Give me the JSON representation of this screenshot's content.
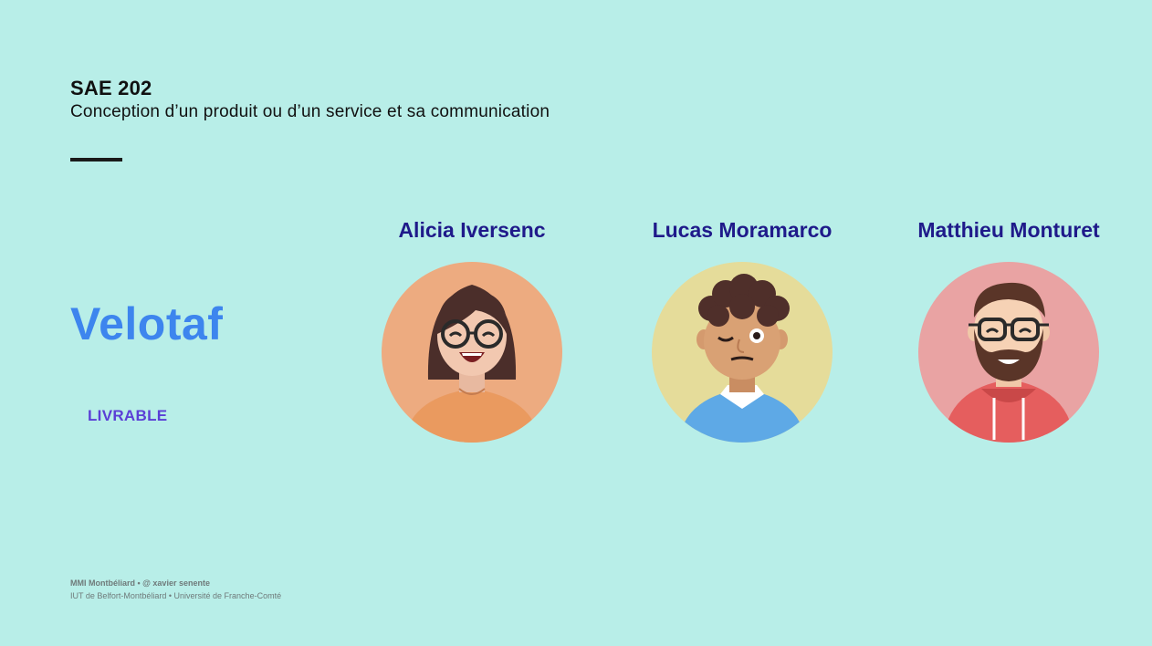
{
  "header": {
    "course_code": "SAE 202",
    "course_subtitle": "Conception d’un produit ou d’un service et sa communication"
  },
  "project": {
    "name": "Velotaf",
    "tag": "LIVRABLE"
  },
  "team": [
    {
      "name": "Alicia Iversenc",
      "avatar_icon": "woman-avatar-icon",
      "avatar_bg": "#edab80"
    },
    {
      "name": "Lucas Moramarco",
      "avatar_icon": "winking-man-avatar-icon",
      "avatar_bg": "#e5dc9a"
    },
    {
      "name": "Matthieu Monturet",
      "avatar_icon": "bearded-man-avatar-icon",
      "avatar_bg": "#e9a3a3"
    }
  ],
  "footer": {
    "line1": "MMI Montbéliard • @ xavier senente",
    "line2": "IUT de Belfort-Montbéliard • Université de Franche-Comté"
  },
  "colors": {
    "background": "#b8eee8",
    "project_name": "#3d85ee",
    "tag": "#5b3fd6",
    "member_name": "#1f1a8a"
  }
}
